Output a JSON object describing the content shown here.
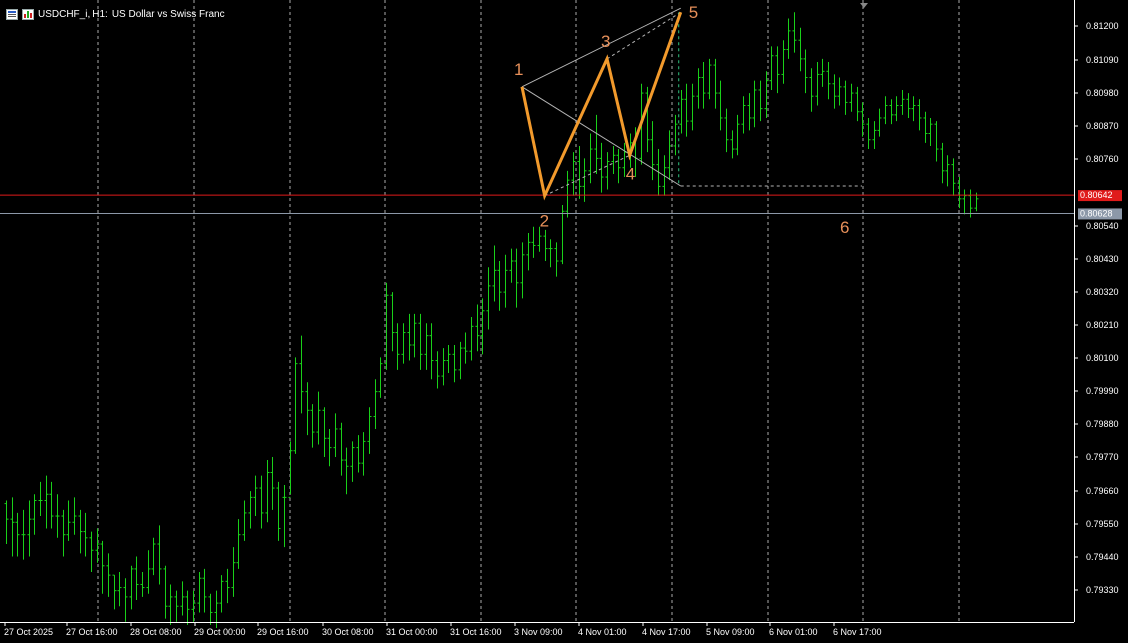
{
  "header": {
    "symbol": "USDCHF_i",
    "timeframe": "H1",
    "description": "US Dollar vs Swiss Franc"
  },
  "colors": {
    "background": "#000000",
    "candle": "#19d019",
    "grid": "#c8c8c8",
    "wave_line": "#f29a2c",
    "wave_label": "#e7905a",
    "channel": "#b4b4b4",
    "red_line": "#e01b1b",
    "bid_line": "#8c98a8"
  },
  "price_axis": {
    "ticks": [
      "0.81200",
      "0.81090",
      "0.80980",
      "0.80870",
      "0.80760",
      "0.80540",
      "0.80430",
      "0.80320",
      "0.80210",
      "0.80100",
      "0.79990",
      "0.79880",
      "0.79770",
      "0.79660",
      "0.79550",
      "0.79440",
      "0.79330"
    ],
    "red_level_label": "0.80642",
    "bid_label": "0.80628"
  },
  "time_axis": {
    "labels": [
      "27 Oct 2025",
      "27 Oct 16:00",
      "28 Oct 08:00",
      "29 Oct 00:00",
      "29 Oct 16:00",
      "30 Oct 08:00",
      "31 Oct 00:00",
      "31 Oct 16:00",
      "3 Nov 09:00",
      "4 Nov 01:00",
      "4 Nov 17:00",
      "5 Nov 09:00",
      "6 Nov 01:00",
      "6 Nov 17:00"
    ]
  },
  "wave_labels": [
    "1",
    "2",
    "3",
    "4",
    "5",
    "6"
  ],
  "chart_data": {
    "type": "candlestick",
    "symbol": "USDCHF_i",
    "timeframe": "H1",
    "ylim": [
      0.7928,
      0.8125
    ],
    "levels": {
      "red_line": 0.80642,
      "bid": 0.80628
    },
    "waves": [
      {
        "label": "1",
        "bar": 91,
        "price": 0.8099
      },
      {
        "label": "2",
        "bar": 95,
        "price": 0.8064
      },
      {
        "label": "3",
        "bar": 106,
        "price": 0.8108
      },
      {
        "label": "4",
        "bar": 110,
        "price": 0.8077
      },
      {
        "label": "5",
        "bar": 119,
        "price": 0.8123
      }
    ],
    "candles": [
      {
        "c": 0.796,
        "h": 0.7966,
        "l": 0.7952,
        "o": 0.7965
      },
      {
        "c": 0.7959,
        "h": 0.7967,
        "l": 0.7948,
        "o": 0.796
      },
      {
        "c": 0.7955,
        "h": 0.7962,
        "l": 0.7948,
        "o": 0.7959
      },
      {
        "c": 0.7955,
        "h": 0.7963,
        "l": 0.7947,
        "o": 0.7955
      },
      {
        "c": 0.796,
        "h": 0.7966,
        "l": 0.7948,
        "o": 0.7955
      },
      {
        "c": 0.7966,
        "h": 0.7968,
        "l": 0.7955,
        "o": 0.796
      },
      {
        "c": 0.7966,
        "h": 0.7972,
        "l": 0.7961,
        "o": 0.7966
      },
      {
        "c": 0.7968,
        "h": 0.7974,
        "l": 0.7957,
        "o": 0.7966
      },
      {
        "c": 0.7961,
        "h": 0.7972,
        "l": 0.7957,
        "o": 0.7968
      },
      {
        "c": 0.7961,
        "h": 0.7968,
        "l": 0.7954,
        "o": 0.7961
      },
      {
        "c": 0.7955,
        "h": 0.7963,
        "l": 0.7948,
        "o": 0.7961
      },
      {
        "c": 0.7959,
        "h": 0.7966,
        "l": 0.7953,
        "o": 0.7955
      },
      {
        "c": 0.7961,
        "h": 0.7967,
        "l": 0.7955,
        "o": 0.7959
      },
      {
        "c": 0.7956,
        "h": 0.7963,
        "l": 0.7949,
        "o": 0.7961
      },
      {
        "c": 0.7954,
        "h": 0.7962,
        "l": 0.7948,
        "o": 0.7956
      },
      {
        "c": 0.795,
        "h": 0.7956,
        "l": 0.7943,
        "o": 0.7954
      },
      {
        "c": 0.7952,
        "h": 0.7957,
        "l": 0.7946,
        "o": 0.795
      },
      {
        "c": 0.7945,
        "h": 0.7953,
        "l": 0.7936,
        "o": 0.7952
      },
      {
        "c": 0.7942,
        "h": 0.7949,
        "l": 0.7935,
        "o": 0.7945
      },
      {
        "c": 0.7937,
        "h": 0.7942,
        "l": 0.7931,
        "o": 0.7942
      },
      {
        "c": 0.7938,
        "h": 0.7943,
        "l": 0.7932,
        "o": 0.7937
      },
      {
        "c": 0.7935,
        "h": 0.7941,
        "l": 0.7927,
        "o": 0.7938
      },
      {
        "c": 0.7944,
        "h": 0.7945,
        "l": 0.7931,
        "o": 0.7935
      },
      {
        "c": 0.7939,
        "h": 0.7948,
        "l": 0.7934,
        "o": 0.7944
      },
      {
        "c": 0.7938,
        "h": 0.7943,
        "l": 0.7935,
        "o": 0.7939
      },
      {
        "c": 0.7944,
        "h": 0.795,
        "l": 0.7936,
        "o": 0.7938
      },
      {
        "c": 0.7952,
        "h": 0.7954,
        "l": 0.7942,
        "o": 0.7944
      },
      {
        "c": 0.7944,
        "h": 0.7958,
        "l": 0.7939,
        "o": 0.7952
      },
      {
        "c": 0.7932,
        "h": 0.7945,
        "l": 0.7928,
        "o": 0.7944
      },
      {
        "c": 0.7935,
        "h": 0.7939,
        "l": 0.7926,
        "o": 0.7932
      },
      {
        "c": 0.7932,
        "h": 0.7937,
        "l": 0.7927,
        "o": 0.7935
      },
      {
        "c": 0.7935,
        "h": 0.794,
        "l": 0.7929,
        "o": 0.7932
      },
      {
        "c": 0.7931,
        "h": 0.7937,
        "l": 0.7926,
        "o": 0.7935
      },
      {
        "c": 0.7933,
        "h": 0.7937,
        "l": 0.7927,
        "o": 0.7931
      },
      {
        "c": 0.7941,
        "h": 0.7943,
        "l": 0.793,
        "o": 0.7933
      },
      {
        "c": 0.7935,
        "h": 0.7944,
        "l": 0.793,
        "o": 0.7941
      },
      {
        "c": 0.793,
        "h": 0.7936,
        "l": 0.7926,
        "o": 0.7935
      },
      {
        "c": 0.7933,
        "h": 0.7937,
        "l": 0.7925,
        "o": 0.793
      },
      {
        "c": 0.794,
        "h": 0.7942,
        "l": 0.793,
        "o": 0.7933
      },
      {
        "c": 0.7938,
        "h": 0.7944,
        "l": 0.7933,
        "o": 0.794
      },
      {
        "c": 0.7946,
        "h": 0.7951,
        "l": 0.7935,
        "o": 0.7938
      },
      {
        "c": 0.7955,
        "h": 0.796,
        "l": 0.7944,
        "o": 0.7946
      },
      {
        "c": 0.7962,
        "h": 0.7966,
        "l": 0.7953,
        "o": 0.7955
      },
      {
        "c": 0.7967,
        "h": 0.7969,
        "l": 0.7957,
        "o": 0.7962
      },
      {
        "c": 0.797,
        "h": 0.7974,
        "l": 0.7961,
        "o": 0.7967
      },
      {
        "c": 0.7962,
        "h": 0.7974,
        "l": 0.7957,
        "o": 0.797
      },
      {
        "c": 0.7975,
        "h": 0.7979,
        "l": 0.7959,
        "o": 0.7962
      },
      {
        "c": 0.797,
        "h": 0.798,
        "l": 0.7963,
        "o": 0.7975
      },
      {
        "c": 0.7957,
        "h": 0.7972,
        "l": 0.7953,
        "o": 0.797
      },
      {
        "c": 0.7967,
        "h": 0.7971,
        "l": 0.7951,
        "o": 0.7967
      },
      {
        "c": 0.7982,
        "h": 0.7985,
        "l": 0.7968,
        "o": 0.7967
      },
      {
        "c": 0.801,
        "h": 0.8012,
        "l": 0.7981,
        "o": 0.7982
      },
      {
        "c": 0.8001,
        "h": 0.8019,
        "l": 0.7994,
        "o": 0.801
      },
      {
        "c": 0.7995,
        "h": 0.8004,
        "l": 0.7987,
        "o": 0.8001
      },
      {
        "c": 0.7988,
        "h": 0.7997,
        "l": 0.7983,
        "o": 0.7995
      },
      {
        "c": 0.7995,
        "h": 0.8001,
        "l": 0.7984,
        "o": 0.7988
      },
      {
        "c": 0.7986,
        "h": 0.7996,
        "l": 0.798,
        "o": 0.7995
      },
      {
        "c": 0.7983,
        "h": 0.7989,
        "l": 0.7977,
        "o": 0.7986
      },
      {
        "c": 0.7989,
        "h": 0.7994,
        "l": 0.798,
        "o": 0.7983
      },
      {
        "c": 0.7979,
        "h": 0.7991,
        "l": 0.7974,
        "o": 0.7989
      },
      {
        "c": 0.7977,
        "h": 0.7983,
        "l": 0.7968,
        "o": 0.7979
      },
      {
        "c": 0.7983,
        "h": 0.7985,
        "l": 0.7972,
        "o": 0.7977
      },
      {
        "c": 0.7978,
        "h": 0.7987,
        "l": 0.7975,
        "o": 0.7983
      },
      {
        "c": 0.7985,
        "h": 0.7988,
        "l": 0.7974,
        "o": 0.7978
      },
      {
        "c": 0.7993,
        "h": 0.7996,
        "l": 0.7981,
        "o": 0.7985
      },
      {
        "c": 0.8001,
        "h": 0.8005,
        "l": 0.7989,
        "o": 0.7993
      },
      {
        "c": 0.801,
        "h": 0.8012,
        "l": 0.7999,
        "o": 0.8001
      },
      {
        "c": 0.8032,
        "h": 0.8036,
        "l": 0.8008,
        "o": 0.801
      },
      {
        "c": 0.802,
        "h": 0.8033,
        "l": 0.8014,
        "o": 0.8032
      },
      {
        "c": 0.8013,
        "h": 0.8023,
        "l": 0.8008,
        "o": 0.802
      },
      {
        "c": 0.802,
        "h": 0.8023,
        "l": 0.801,
        "o": 0.8013
      },
      {
        "c": 0.8016,
        "h": 0.8026,
        "l": 0.8011,
        "o": 0.802
      },
      {
        "c": 0.8023,
        "h": 0.8026,
        "l": 0.8012,
        "o": 0.8016
      },
      {
        "c": 0.8013,
        "h": 0.8026,
        "l": 0.8008,
        "o": 0.8023
      },
      {
        "c": 0.8019,
        "h": 0.8023,
        "l": 0.8008,
        "o": 0.8013
      },
      {
        "c": 0.8011,
        "h": 0.8023,
        "l": 0.8005,
        "o": 0.8019
      },
      {
        "c": 0.8006,
        "h": 0.8014,
        "l": 0.8002,
        "o": 0.8011
      },
      {
        "c": 0.8011,
        "h": 0.8015,
        "l": 0.8003,
        "o": 0.8006
      },
      {
        "c": 0.8013,
        "h": 0.8016,
        "l": 0.8007,
        "o": 0.8011
      },
      {
        "c": 0.8008,
        "h": 0.8016,
        "l": 0.8004,
        "o": 0.8013
      },
      {
        "c": 0.8015,
        "h": 0.8017,
        "l": 0.8005,
        "o": 0.8008
      },
      {
        "c": 0.8014,
        "h": 0.802,
        "l": 0.801,
        "o": 0.8015
      },
      {
        "c": 0.8022,
        "h": 0.8025,
        "l": 0.8011,
        "o": 0.8014
      },
      {
        "c": 0.8019,
        "h": 0.8029,
        "l": 0.8014,
        "o": 0.8022
      },
      {
        "c": 0.8027,
        "h": 0.8031,
        "l": 0.8013,
        "o": 0.8019
      },
      {
        "c": 0.8035,
        "h": 0.8041,
        "l": 0.8021,
        "o": 0.8027
      },
      {
        "c": 0.804,
        "h": 0.8048,
        "l": 0.803,
        "o": 0.8035
      },
      {
        "c": 0.8033,
        "h": 0.8043,
        "l": 0.8027,
        "o": 0.804
      },
      {
        "c": 0.804,
        "h": 0.8045,
        "l": 0.8028,
        "o": 0.8033
      },
      {
        "c": 0.8043,
        "h": 0.8047,
        "l": 0.8036,
        "o": 0.804
      },
      {
        "c": 0.8036,
        "h": 0.8047,
        "l": 0.8028,
        "o": 0.8043
      },
      {
        "c": 0.8045,
        "h": 0.8049,
        "l": 0.8031,
        "o": 0.8036
      },
      {
        "c": 0.8049,
        "h": 0.8052,
        "l": 0.804,
        "o": 0.8045
      },
      {
        "c": 0.8048,
        "h": 0.8054,
        "l": 0.8044,
        "o": 0.8049
      },
      {
        "c": 0.8051,
        "h": 0.8054,
        "l": 0.8046,
        "o": 0.8048
      },
      {
        "c": 0.8047,
        "h": 0.8053,
        "l": 0.8043,
        "o": 0.8051
      },
      {
        "c": 0.8047,
        "h": 0.805,
        "l": 0.8041,
        "o": 0.8047
      },
      {
        "c": 0.8043,
        "h": 0.8049,
        "l": 0.8038,
        "o": 0.8047
      },
      {
        "c": 0.8059,
        "h": 0.8061,
        "l": 0.8042,
        "o": 0.8043
      },
      {
        "c": 0.8069,
        "h": 0.8072,
        "l": 0.8057,
        "o": 0.8059
      },
      {
        "c": 0.8075,
        "h": 0.8078,
        "l": 0.8064,
        "o": 0.8069
      },
      {
        "c": 0.8067,
        "h": 0.808,
        "l": 0.8063,
        "o": 0.8075
      },
      {
        "c": 0.8072,
        "h": 0.8076,
        "l": 0.8062,
        "o": 0.8067
      },
      {
        "c": 0.8079,
        "h": 0.8084,
        "l": 0.8068,
        "o": 0.8072
      },
      {
        "c": 0.8076,
        "h": 0.809,
        "l": 0.8071,
        "o": 0.8079
      },
      {
        "c": 0.807,
        "h": 0.8081,
        "l": 0.8065,
        "o": 0.8076
      },
      {
        "c": 0.8075,
        "h": 0.8078,
        "l": 0.8066,
        "o": 0.807
      },
      {
        "c": 0.8077,
        "h": 0.808,
        "l": 0.8071,
        "o": 0.8075
      },
      {
        "c": 0.8073,
        "h": 0.8079,
        "l": 0.8068,
        "o": 0.8077
      },
      {
        "c": 0.8078,
        "h": 0.8081,
        "l": 0.807,
        "o": 0.8073
      },
      {
        "c": 0.8081,
        "h": 0.8084,
        "l": 0.8073,
        "o": 0.8078
      },
      {
        "c": 0.8076,
        "h": 0.8086,
        "l": 0.807,
        "o": 0.8081
      },
      {
        "c": 0.8097,
        "h": 0.81,
        "l": 0.8074,
        "o": 0.8076
      },
      {
        "c": 0.8082,
        "h": 0.8099,
        "l": 0.8078,
        "o": 0.8097
      },
      {
        "c": 0.8074,
        "h": 0.8088,
        "l": 0.8069,
        "o": 0.8082
      },
      {
        "c": 0.8067,
        "h": 0.8079,
        "l": 0.8064,
        "o": 0.8074
      },
      {
        "c": 0.8073,
        "h": 0.8077,
        "l": 0.8064,
        "o": 0.8067
      },
      {
        "c": 0.808,
        "h": 0.8085,
        "l": 0.8069,
        "o": 0.8073
      },
      {
        "c": 0.8087,
        "h": 0.809,
        "l": 0.8077,
        "o": 0.808
      },
      {
        "c": 0.8095,
        "h": 0.8098,
        "l": 0.8084,
        "o": 0.8087
      },
      {
        "c": 0.8088,
        "h": 0.81,
        "l": 0.8083,
        "o": 0.8095
      },
      {
        "c": 0.8096,
        "h": 0.81,
        "l": 0.8085,
        "o": 0.8088
      },
      {
        "c": 0.8102,
        "h": 0.8105,
        "l": 0.8092,
        "o": 0.8096
      },
      {
        "c": 0.8097,
        "h": 0.8107,
        "l": 0.8092,
        "o": 0.8102
      },
      {
        "c": 0.8106,
        "h": 0.8108,
        "l": 0.8095,
        "o": 0.8097
      },
      {
        "c": 0.8097,
        "h": 0.8108,
        "l": 0.8092,
        "o": 0.8106
      },
      {
        "c": 0.8089,
        "h": 0.8101,
        "l": 0.8085,
        "o": 0.8097
      },
      {
        "c": 0.8082,
        "h": 0.8092,
        "l": 0.8078,
        "o": 0.8089
      },
      {
        "c": 0.8079,
        "h": 0.8085,
        "l": 0.8076,
        "o": 0.8082
      },
      {
        "c": 0.8087,
        "h": 0.809,
        "l": 0.8077,
        "o": 0.8079
      },
      {
        "c": 0.8093,
        "h": 0.8096,
        "l": 0.8084,
        "o": 0.8087
      },
      {
        "c": 0.8089,
        "h": 0.8097,
        "l": 0.8085,
        "o": 0.8093
      },
      {
        "c": 0.8098,
        "h": 0.8101,
        "l": 0.8086,
        "o": 0.8089
      },
      {
        "c": 0.8092,
        "h": 0.8101,
        "l": 0.8088,
        "o": 0.8098
      },
      {
        "c": 0.8101,
        "h": 0.8104,
        "l": 0.8089,
        "o": 0.8092
      },
      {
        "c": 0.8109,
        "h": 0.8112,
        "l": 0.8098,
        "o": 0.8101
      },
      {
        "c": 0.8103,
        "h": 0.8112,
        "l": 0.8097,
        "o": 0.8109
      },
      {
        "c": 0.8111,
        "h": 0.8114,
        "l": 0.81,
        "o": 0.8103
      },
      {
        "c": 0.8117,
        "h": 0.8121,
        "l": 0.8108,
        "o": 0.8111
      },
      {
        "c": 0.8114,
        "h": 0.8123,
        "l": 0.811,
        "o": 0.8117
      },
      {
        "c": 0.8108,
        "h": 0.8118,
        "l": 0.8104,
        "o": 0.8114
      },
      {
        "c": 0.8102,
        "h": 0.8111,
        "l": 0.8097,
        "o": 0.8108
      },
      {
        "c": 0.8096,
        "h": 0.8105,
        "l": 0.8091,
        "o": 0.8102
      },
      {
        "c": 0.8103,
        "h": 0.8107,
        "l": 0.8093,
        "o": 0.8096
      },
      {
        "c": 0.8104,
        "h": 0.8108,
        "l": 0.8099,
        "o": 0.8103
      },
      {
        "c": 0.81,
        "h": 0.8107,
        "l": 0.8095,
        "o": 0.8104
      },
      {
        "c": 0.8096,
        "h": 0.8103,
        "l": 0.8092,
        "o": 0.81
      },
      {
        "c": 0.8099,
        "h": 0.8102,
        "l": 0.8093,
        "o": 0.8096
      },
      {
        "c": 0.8094,
        "h": 0.8101,
        "l": 0.809,
        "o": 0.8099
      },
      {
        "c": 0.8097,
        "h": 0.81,
        "l": 0.8091,
        "o": 0.8094
      },
      {
        "c": 0.8091,
        "h": 0.8099,
        "l": 0.8088,
        "o": 0.8097
      },
      {
        "c": 0.8087,
        "h": 0.8094,
        "l": 0.8083,
        "o": 0.8091
      },
      {
        "c": 0.8082,
        "h": 0.8089,
        "l": 0.8079,
        "o": 0.8087
      },
      {
        "c": 0.8085,
        "h": 0.8088,
        "l": 0.8079,
        "o": 0.8082
      },
      {
        "c": 0.8089,
        "h": 0.8092,
        "l": 0.8083,
        "o": 0.8085
      },
      {
        "c": 0.8093,
        "h": 0.8096,
        "l": 0.8087,
        "o": 0.8089
      },
      {
        "c": 0.809,
        "h": 0.8095,
        "l": 0.8087,
        "o": 0.8093
      },
      {
        "c": 0.8093,
        "h": 0.8096,
        "l": 0.8088,
        "o": 0.809
      },
      {
        "c": 0.8095,
        "h": 0.8098,
        "l": 0.809,
        "o": 0.8093
      },
      {
        "c": 0.8092,
        "h": 0.8097,
        "l": 0.8089,
        "o": 0.8095
      },
      {
        "c": 0.8093,
        "h": 0.8096,
        "l": 0.8088,
        "o": 0.8092
      },
      {
        "c": 0.8089,
        "h": 0.8095,
        "l": 0.8085,
        "o": 0.8093
      },
      {
        "c": 0.8084,
        "h": 0.8091,
        "l": 0.8081,
        "o": 0.8089
      },
      {
        "c": 0.8087,
        "h": 0.8089,
        "l": 0.808,
        "o": 0.8084
      },
      {
        "c": 0.8079,
        "h": 0.8088,
        "l": 0.8075,
        "o": 0.8087
      },
      {
        "c": 0.8072,
        "h": 0.8081,
        "l": 0.8068,
        "o": 0.8079
      },
      {
        "c": 0.8074,
        "h": 0.8077,
        "l": 0.8067,
        "o": 0.8072
      },
      {
        "c": 0.8068,
        "h": 0.8076,
        "l": 0.8064,
        "o": 0.8074
      },
      {
        "c": 0.8063,
        "h": 0.807,
        "l": 0.806,
        "o": 0.8068
      },
      {
        "c": 0.8064,
        "h": 0.8066,
        "l": 0.8058,
        "o": 0.8063
      },
      {
        "c": 0.806,
        "h": 0.8066,
        "l": 0.8057,
        "o": 0.8064
      },
      {
        "c": 0.8063,
        "h": 0.8065,
        "l": 0.8059,
        "o": 0.806
      }
    ]
  }
}
